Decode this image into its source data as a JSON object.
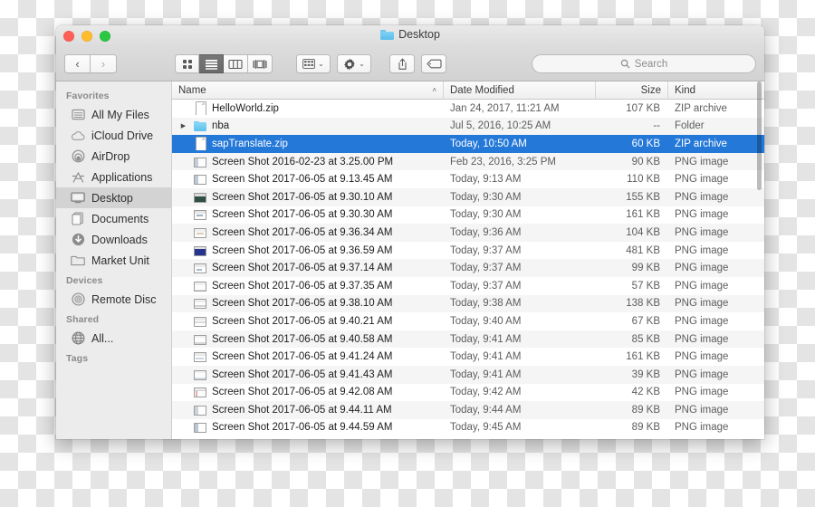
{
  "window": {
    "title": "Desktop",
    "title_icon": "folder-icon",
    "controls": [
      {
        "name": "close-button",
        "color": "#ff5f57"
      },
      {
        "name": "minimize-button",
        "color": "#febc2e"
      },
      {
        "name": "zoom-button",
        "color": "#28c840"
      }
    ]
  },
  "toolbar": {
    "back_label": "‹",
    "forward_label": "›",
    "view_modes": [
      {
        "name": "icon-view-button",
        "icon": "grid-icon",
        "active": false
      },
      {
        "name": "list-view-button",
        "icon": "list-icon",
        "active": true
      },
      {
        "name": "column-view-button",
        "icon": "columns-icon",
        "active": false
      },
      {
        "name": "cover-flow-view-button",
        "icon": "coverflow-icon",
        "active": false
      }
    ],
    "arrange_label": "arrange-icon",
    "action_label": "gear-icon",
    "share_label": "share-icon",
    "tags_label": "tag-icon",
    "chevron": "⌄"
  },
  "search": {
    "placeholder": "Search",
    "value": "",
    "icon": "search-icon"
  },
  "sidebar": {
    "sections": [
      {
        "heading": "Favorites",
        "items": [
          {
            "label": "All My Files",
            "icon": "all-my-files-icon",
            "selected": false
          },
          {
            "label": "iCloud Drive",
            "icon": "icloud-icon",
            "selected": false
          },
          {
            "label": "AirDrop",
            "icon": "airdrop-icon",
            "selected": false
          },
          {
            "label": "Applications",
            "icon": "applications-icon",
            "selected": false
          },
          {
            "label": "Desktop",
            "icon": "desktop-icon",
            "selected": true
          },
          {
            "label": "Documents",
            "icon": "documents-icon",
            "selected": false
          },
          {
            "label": "Downloads",
            "icon": "downloads-icon",
            "selected": false
          },
          {
            "label": "Market Unit",
            "icon": "folder-icon",
            "selected": false
          }
        ]
      },
      {
        "heading": "Devices",
        "items": [
          {
            "label": "Remote Disc",
            "icon": "disc-icon",
            "selected": false
          }
        ]
      },
      {
        "heading": "Shared",
        "items": [
          {
            "label": "All...",
            "icon": "network-icon",
            "selected": false
          }
        ]
      },
      {
        "heading": "Tags",
        "items": []
      }
    ]
  },
  "filelist": {
    "columns": [
      {
        "key": "name",
        "label": "Name",
        "sorted": true,
        "sort_caret": "˄"
      },
      {
        "key": "date",
        "label": "Date Modified"
      },
      {
        "key": "size",
        "label": "Size"
      },
      {
        "key": "kind",
        "label": "Kind"
      }
    ],
    "rows": [
      {
        "name": "HelloWorld.zip",
        "date": "Jan 24, 2017, 11:21 AM",
        "size": "107 KB",
        "kind": "ZIP archive",
        "icon": "zip-icon",
        "expandable": false,
        "selected": false
      },
      {
        "name": "nba",
        "date": "Jul 5, 2016, 10:25 AM",
        "size": "--",
        "kind": "Folder",
        "icon": "folder-icon",
        "expandable": true,
        "selected": false
      },
      {
        "name": "sapTranslate.zip",
        "date": "Today, 10:50 AM",
        "size": "60 KB",
        "kind": "ZIP archive",
        "icon": "zip-icon",
        "expandable": false,
        "selected": true
      },
      {
        "name": "Screen Shot 2016-02-23 at 3.25.00 PM",
        "date": "Feb 23, 2016, 3:25 PM",
        "size": "90 KB",
        "kind": "PNG image",
        "icon": "png-icon",
        "expandable": false,
        "selected": false
      },
      {
        "name": "Screen Shot 2017-06-05 at 9.13.45 AM",
        "date": "Today, 9:13 AM",
        "size": "110 KB",
        "kind": "PNG image",
        "icon": "png-icon",
        "expandable": false,
        "selected": false
      },
      {
        "name": "Screen Shot 2017-06-05 at 9.30.10 AM",
        "date": "Today, 9:30 AM",
        "size": "155 KB",
        "kind": "PNG image",
        "icon": "png-icon",
        "expandable": false,
        "selected": false
      },
      {
        "name": "Screen Shot 2017-06-05 at 9.30.30 AM",
        "date": "Today, 9:30 AM",
        "size": "161 KB",
        "kind": "PNG image",
        "icon": "png-icon",
        "expandable": false,
        "selected": false
      },
      {
        "name": "Screen Shot 2017-06-05 at 9.36.34 AM",
        "date": "Today, 9:36 AM",
        "size": "104 KB",
        "kind": "PNG image",
        "icon": "png-icon",
        "expandable": false,
        "selected": false
      },
      {
        "name": "Screen Shot 2017-06-05 at 9.36.59 AM",
        "date": "Today, 9:37 AM",
        "size": "481 KB",
        "kind": "PNG image",
        "icon": "png-icon",
        "expandable": false,
        "selected": false
      },
      {
        "name": "Screen Shot 2017-06-05 at 9.37.14 AM",
        "date": "Today, 9:37 AM",
        "size": "99 KB",
        "kind": "PNG image",
        "icon": "png-icon",
        "expandable": false,
        "selected": false
      },
      {
        "name": "Screen Shot 2017-06-05 at 9.37.35 AM",
        "date": "Today, 9:37 AM",
        "size": "57 KB",
        "kind": "PNG image",
        "icon": "png-icon",
        "expandable": false,
        "selected": false
      },
      {
        "name": "Screen Shot 2017-06-05 at 9.38.10 AM",
        "date": "Today, 9:38 AM",
        "size": "138 KB",
        "kind": "PNG image",
        "icon": "png-icon",
        "expandable": false,
        "selected": false
      },
      {
        "name": "Screen Shot 2017-06-05 at 9.40.21 AM",
        "date": "Today, 9:40 AM",
        "size": "67 KB",
        "kind": "PNG image",
        "icon": "png-icon",
        "expandable": false,
        "selected": false
      },
      {
        "name": "Screen Shot 2017-06-05 at 9.40.58 AM",
        "date": "Today, 9:41 AM",
        "size": "85 KB",
        "kind": "PNG image",
        "icon": "png-icon",
        "expandable": false,
        "selected": false
      },
      {
        "name": "Screen Shot 2017-06-05 at 9.41.24 AM",
        "date": "Today, 9:41 AM",
        "size": "161 KB",
        "kind": "PNG image",
        "icon": "png-icon",
        "expandable": false,
        "selected": false
      },
      {
        "name": "Screen Shot 2017-06-05 at 9.41.43 AM",
        "date": "Today, 9:41 AM",
        "size": "39 KB",
        "kind": "PNG image",
        "icon": "png-icon",
        "expandable": false,
        "selected": false
      },
      {
        "name": "Screen Shot 2017-06-05 at 9.42.08 AM",
        "date": "Today, 9:42 AM",
        "size": "42 KB",
        "kind": "PNG image",
        "icon": "png-icon",
        "expandable": false,
        "selected": false
      },
      {
        "name": "Screen Shot 2017-06-05 at 9.44.11 AM",
        "date": "Today, 9:44 AM",
        "size": "89 KB",
        "kind": "PNG image",
        "icon": "png-icon",
        "expandable": false,
        "selected": false
      },
      {
        "name": "Screen Shot 2017-06-05 at 9.44.59 AM",
        "date": "Today, 9:45 AM",
        "size": "89 KB",
        "kind": "PNG image",
        "icon": "png-icon",
        "expandable": false,
        "selected": false
      }
    ]
  },
  "colors": {
    "selection": "#2478d8",
    "sidebar_bg": "#ececec",
    "folder_blue": "#5fc0ed"
  }
}
